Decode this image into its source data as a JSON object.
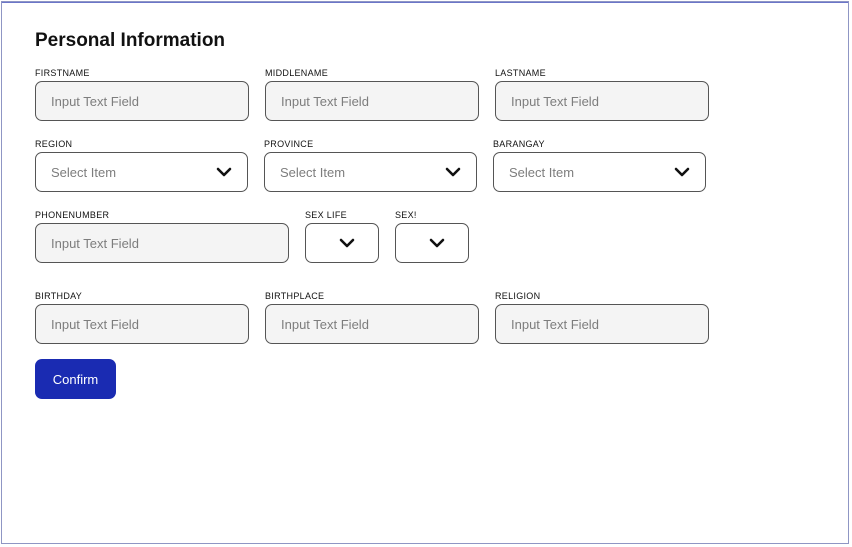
{
  "form": {
    "title": "Personal Information",
    "fields": {
      "firstname": {
        "label": "FIRSTNAME",
        "placeholder": "Input Text Field"
      },
      "middlename": {
        "label": "MIDDLENAME",
        "placeholder": "Input Text Field"
      },
      "lastname": {
        "label": "LASTNAME",
        "placeholder": "Input Text Field"
      },
      "region": {
        "label": "REGION",
        "value": "Select Item"
      },
      "province": {
        "label": "PROVINCE",
        "value": "Select Item"
      },
      "barangay": {
        "label": "BARANGAY",
        "value": "Select Item"
      },
      "phonenumber": {
        "label": "PHONENUMBER",
        "placeholder": "Input Text Field"
      },
      "sex_life": {
        "label": "SEX LIFE"
      },
      "sex": {
        "label": "SEX!"
      },
      "birthday": {
        "label": "BIRTHDAY",
        "placeholder": "Input Text Field"
      },
      "birthplace": {
        "label": "BIRTHPLACE",
        "placeholder": "Input Text Field"
      },
      "religion": {
        "label": "RELIGION",
        "placeholder": "Input Text Field"
      }
    },
    "confirm_label": "Confirm"
  },
  "icons": {
    "dropdown": "chevron-down-icon"
  },
  "colors": {
    "primary": "#1a2bb2",
    "input_bg": "#f4f4f4",
    "border": "#555555",
    "frame_border": "#8f96c4"
  }
}
